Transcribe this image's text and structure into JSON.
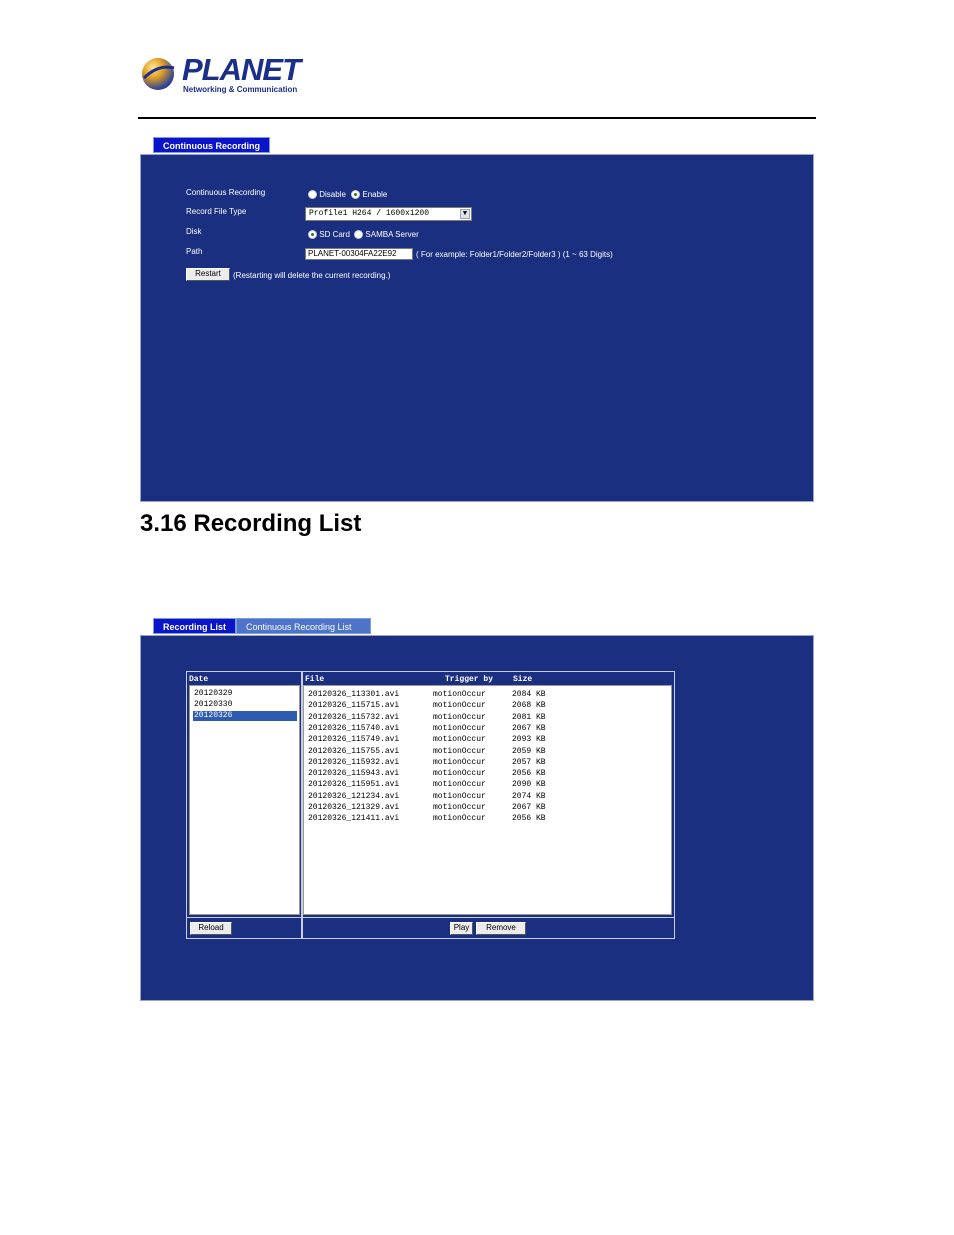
{
  "brand": {
    "name": "PLANET",
    "tagline": "Networking & Communication",
    "colors": {
      "logo": "#1b2f8a",
      "panel": "#1b2f80",
      "tab_active": "#0a14c8",
      "tab_inactive": "#4d74c9"
    }
  },
  "continuous_recording": {
    "tab_label": "Continuous Recording",
    "fields": {
      "recording_label": "Continuous Recording",
      "disable_label": "Disable",
      "enable_label": "Enable",
      "selected_mode": "Enable",
      "file_type_label": "Record File Type",
      "file_type_value": "Profile1 H264 / 1600x1200",
      "disk_label": "Disk",
      "sd_card_label": "SD Card",
      "samba_label": "SAMBA Server",
      "selected_disk": "SD Card",
      "path_label": "Path",
      "path_value": "PLANET-00304FA22E92",
      "path_hint": "( For example: Folder1/Folder2/Folder3 ) (1 ~ 63 Digits)",
      "restart_label": "Restart",
      "restart_hint": "(Restarting will delete the current recording.)"
    }
  },
  "section": {
    "title": "3.16 Recording List"
  },
  "recording_list": {
    "tabs": [
      {
        "label": "Recording List",
        "active": true
      },
      {
        "label": "Continuous Recording List",
        "active": false
      }
    ],
    "columns": {
      "date": "Date",
      "file": "File",
      "trigger": "Trigger by",
      "size": "Size"
    },
    "dates": [
      "20120329",
      "20120330",
      "20120326"
    ],
    "selected_date": "20120326",
    "files": [
      {
        "file": "20120326_113301.avi",
        "trigger": "motionOccur",
        "size": "2084 KB"
      },
      {
        "file": "20120326_115715.avi",
        "trigger": "motionOccur",
        "size": "2068 KB"
      },
      {
        "file": "20120326_115732.avi",
        "trigger": "motionOccur",
        "size": "2081 KB"
      },
      {
        "file": "20120326_115740.avi",
        "trigger": "motionOccur",
        "size": "2067 KB"
      },
      {
        "file": "20120326_115749.avi",
        "trigger": "motionOccur",
        "size": "2093 KB"
      },
      {
        "file": "20120326_115755.avi",
        "trigger": "motionOccur",
        "size": "2059 KB"
      },
      {
        "file": "20120326_115932.avi",
        "trigger": "motionOccur",
        "size": "2057 KB"
      },
      {
        "file": "20120326_115943.avi",
        "trigger": "motionOccur",
        "size": "2056 KB"
      },
      {
        "file": "20120326_115951.avi",
        "trigger": "motionOccur",
        "size": "2090 KB"
      },
      {
        "file": "20120326_121234.avi",
        "trigger": "motionOccur",
        "size": "2074 KB"
      },
      {
        "file": "20120326_121329.avi",
        "trigger": "motionOccur",
        "size": "2067 KB"
      },
      {
        "file": "20120326_121411.avi",
        "trigger": "motionOccur",
        "size": "2056 KB"
      }
    ],
    "buttons": {
      "reload": "Reload",
      "play": "Play",
      "remove": "Remove"
    }
  }
}
